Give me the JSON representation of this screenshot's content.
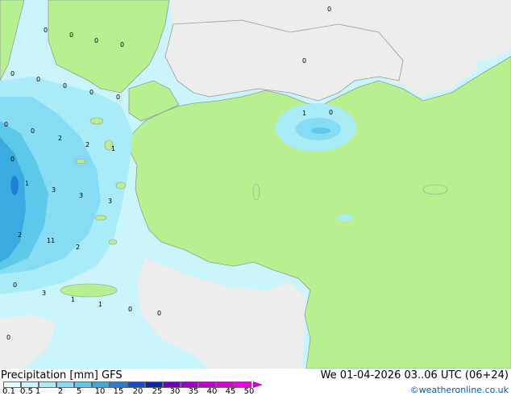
{
  "map": {
    "colors": {
      "background_precip": "#c8f4fa",
      "land": "#b8f090",
      "no_precip": "#ececec",
      "border": "#999999"
    },
    "value_labels": [
      "0",
      "0",
      "0",
      "0",
      "0",
      "0",
      "0",
      "0",
      "0",
      "0",
      "0",
      "0",
      "0",
      "0",
      "1",
      "0",
      "2",
      "2",
      "1",
      "1",
      "3",
      "3",
      "3",
      "2",
      "11",
      "2",
      "0",
      "3",
      "1",
      "1",
      "0",
      "0",
      "0"
    ]
  },
  "footer": {
    "title": "Precipitation [mm] GFS",
    "timestamp": "We 01-04-2026 03..06 UTC (06+24)",
    "credit": "©weatheronline.co.uk",
    "legend_ticks": [
      "0.1",
      "0.5",
      "1",
      "2",
      "5",
      "10",
      "15",
      "20",
      "25",
      "30",
      "35",
      "40",
      "45",
      "50"
    ],
    "legend_colors": [
      "#e8fafc",
      "#c8f4fa",
      "#a8ecf6",
      "#86dcf2",
      "#5ec8ea",
      "#3aaae0",
      "#2480d6",
      "#1450c4",
      "#0a2a9a",
      "#7000b0",
      "#9c00c4",
      "#c000cc",
      "#dc00d8",
      "#f000e0"
    ]
  }
}
